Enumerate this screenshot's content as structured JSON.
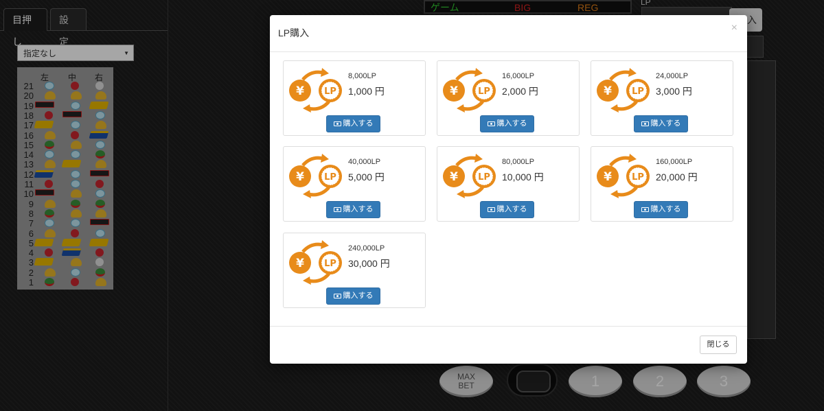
{
  "left_panel": {
    "tabs": [
      {
        "label": "目押し"
      },
      {
        "label": "設定"
      }
    ],
    "select_value": "指定なし",
    "reel_headers": [
      "左",
      "中",
      "右"
    ],
    "reel_rows": [
      {
        "num": "21",
        "syms": [
          "replay",
          "cherry",
          "gray"
        ]
      },
      {
        "num": "20",
        "syms": [
          "bell",
          "bell",
          "bell"
        ]
      },
      {
        "num": "19",
        "syms": [
          "bar",
          "replay",
          "seven"
        ]
      },
      {
        "num": "18",
        "syms": [
          "cherry",
          "bar",
          "replay"
        ]
      },
      {
        "num": "17",
        "syms": [
          "seven",
          "replay",
          "bell"
        ]
      },
      {
        "num": "16",
        "syms": [
          "bell",
          "cherry",
          "blue7"
        ]
      },
      {
        "num": "15",
        "syms": [
          "melon",
          "bell",
          "replay"
        ]
      },
      {
        "num": "14",
        "syms": [
          "replay",
          "replay",
          "melon"
        ]
      },
      {
        "num": "13",
        "syms": [
          "bell",
          "seven",
          "bell"
        ]
      },
      {
        "num": "12",
        "syms": [
          "blue7",
          "replay",
          "bar"
        ]
      },
      {
        "num": "11",
        "syms": [
          "cherry",
          "replay",
          "cherry"
        ]
      },
      {
        "num": "10",
        "syms": [
          "bar",
          "bell",
          "replay"
        ]
      },
      {
        "num": "9",
        "syms": [
          "bell",
          "melon",
          "melon"
        ]
      },
      {
        "num": "8",
        "syms": [
          "melon",
          "bell",
          "bell"
        ]
      },
      {
        "num": "7",
        "syms": [
          "replay",
          "replay",
          "bar"
        ]
      },
      {
        "num": "6",
        "syms": [
          "bell",
          "cherry",
          "replay"
        ]
      },
      {
        "num": "5",
        "syms": [
          "seven",
          "seven",
          "seven"
        ]
      },
      {
        "num": "4",
        "syms": [
          "cherry",
          "blue7",
          "cherry"
        ]
      },
      {
        "num": "3",
        "syms": [
          "seven",
          "bell",
          "gray"
        ]
      },
      {
        "num": "2",
        "syms": [
          "bell",
          "replay",
          "melon"
        ]
      },
      {
        "num": "1",
        "syms": [
          "melon",
          "cherry",
          "bell"
        ]
      }
    ]
  },
  "game": {
    "counters": {
      "game": "ゲーム",
      "big": "BIG",
      "reg": "REG"
    },
    "lp_label": "LP",
    "buy_partial": "入",
    "max_bet": "MAX BET",
    "stop_buttons": [
      "1",
      "2",
      "3"
    ]
  },
  "modal": {
    "title": "LP購入",
    "close_x": "×",
    "buy_label": "購入する",
    "close_label": "閉じる",
    "products": [
      {
        "lp": "8,000LP",
        "price": "1,000 円"
      },
      {
        "lp": "16,000LP",
        "price": "2,000 円"
      },
      {
        "lp": "24,000LP",
        "price": "3,000 円"
      },
      {
        "lp": "40,000LP",
        "price": "5,000 円"
      },
      {
        "lp": "80,000LP",
        "price": "10,000 円"
      },
      {
        "lp": "160,000LP",
        "price": "20,000 円"
      },
      {
        "lp": "240,000LP",
        "price": "30,000 円"
      }
    ]
  },
  "colors": {
    "accent": "#337ab7",
    "icon_orange": "#e88b1a"
  }
}
